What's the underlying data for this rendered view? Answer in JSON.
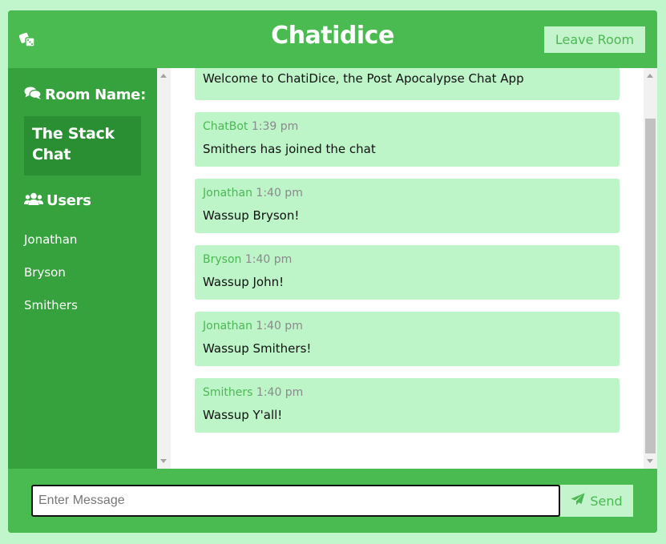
{
  "header": {
    "logo_icon": "dice-icon",
    "title": "Chatidice",
    "leave_label": "Leave Room"
  },
  "sidebar": {
    "room_heading": "Room Name:",
    "room_icon": "comments-icon",
    "room_name": "The Stack Chat",
    "users_heading": "Users",
    "users_icon": "users-icon",
    "users": [
      "Jonathan",
      "Bryson",
      "Smithers"
    ]
  },
  "messages": [
    {
      "author": "",
      "time": "",
      "text": "Welcome to ChatiDice, the Post Apocalypse Chat App"
    },
    {
      "author": "ChatBot",
      "time": "1:39 pm",
      "text": "Smithers has joined the chat"
    },
    {
      "author": "Jonathan",
      "time": "1:40 pm",
      "text": "Wassup Bryson!"
    },
    {
      "author": "Bryson",
      "time": "1:40 pm",
      "text": "Wassup John!"
    },
    {
      "author": "Jonathan",
      "time": "1:40 pm",
      "text": "Wassup Smithers!"
    },
    {
      "author": "Smithers",
      "time": "1:40 pm",
      "text": "Wassup Y'all!"
    }
  ],
  "composer": {
    "placeholder": "Enter Message",
    "value": "",
    "send_label": "Send",
    "send_icon": "paper-plane-icon"
  },
  "colors": {
    "background": "#c1f5cb",
    "header": "#4abb51",
    "sidebar": "#35a23d",
    "room_box": "#2a8e32",
    "message_bubble": "#bdf4c8",
    "accent_text": "#4cb853"
  }
}
